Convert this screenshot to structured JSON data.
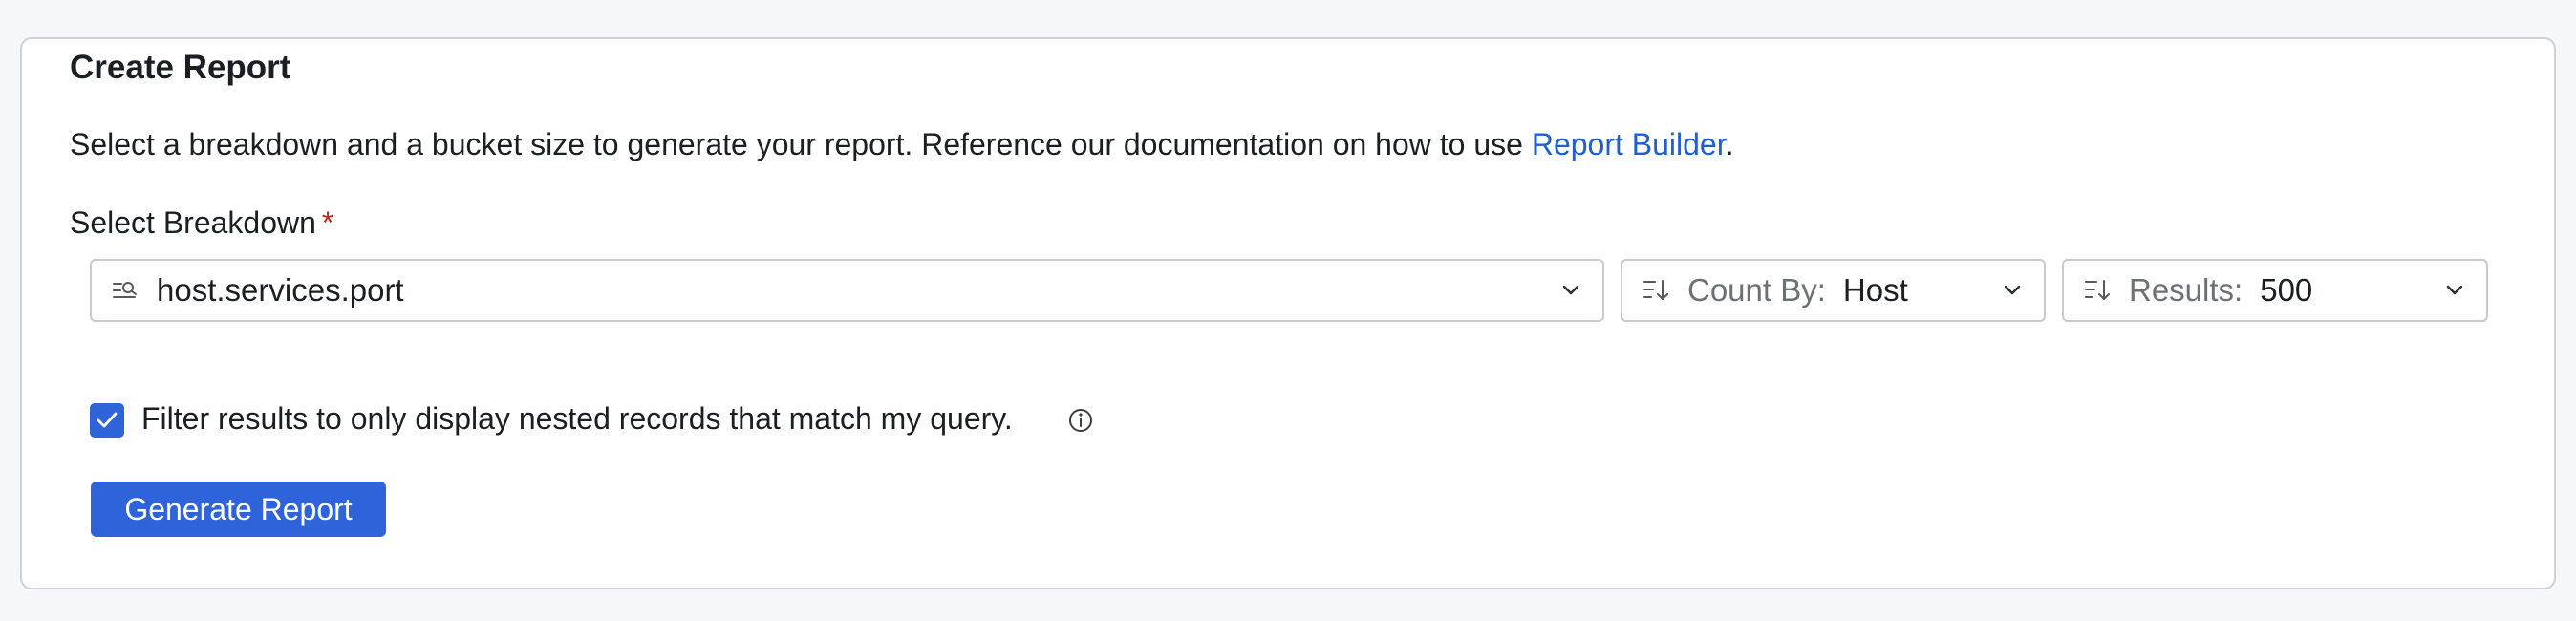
{
  "card": {
    "title": "Create Report",
    "description_prefix": "Select a breakdown and a bucket size to generate your report. Reference our documentation on how to use ",
    "description_link": "Report Builder",
    "description_suffix": "."
  },
  "breakdown": {
    "label": "Select Breakdown",
    "required_marker": "*",
    "value": "host.services.port",
    "icon": "search-list-icon"
  },
  "count_by": {
    "label": "Count By:",
    "value": "Host",
    "icon": "sort-icon"
  },
  "results": {
    "label": "Results:",
    "value": "500",
    "icon": "sort-icon"
  },
  "filter": {
    "checked": true,
    "label": "Filter results to only display nested records that match my query."
  },
  "actions": {
    "generate_label": "Generate Report"
  },
  "colors": {
    "accent": "#2f63d9",
    "link": "#1f5fd1",
    "required": "#c3231b",
    "border": "#c7cbd1",
    "background": "#f6f7f9"
  }
}
